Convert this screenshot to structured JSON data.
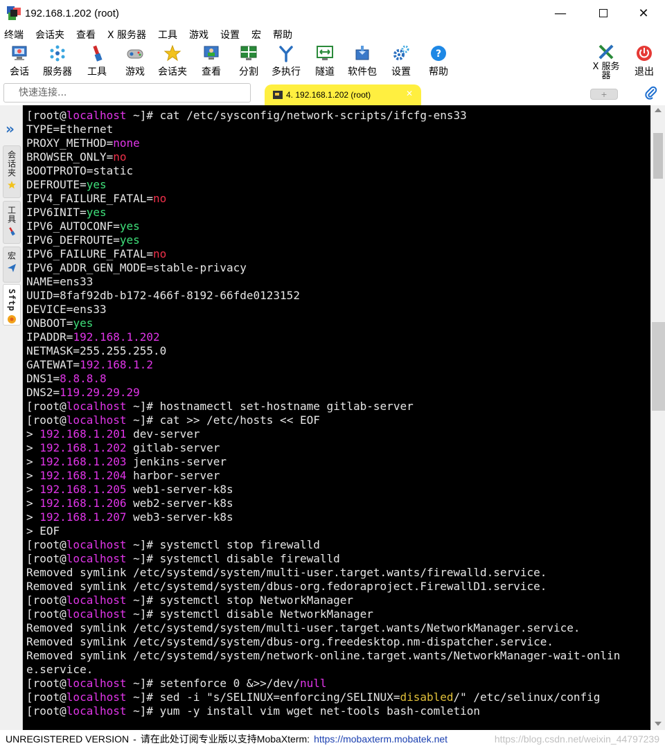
{
  "window": {
    "title": "192.168.1.202 (root)",
    "minimize": "—",
    "close": "✕"
  },
  "menu": [
    "终端",
    "会话夹",
    "查看",
    "X 服务器",
    "工具",
    "游戏",
    "设置",
    "宏",
    "帮助"
  ],
  "toolbar": {
    "session": "会话",
    "servers": "服务器",
    "tools": "工具",
    "games": "游戏",
    "sessions_folder": "会话夹",
    "view": "查看",
    "split": "分割",
    "multiexec": "多执行",
    "tunneling": "隧道",
    "packages": "软件包",
    "settings": "设置",
    "help": "帮助",
    "xserver": "X 服务器",
    "exit": "退出"
  },
  "quick_connect": {
    "placeholder": "快速连接..."
  },
  "tab": {
    "label": "4. 192.168.1.202 (root)",
    "close": "✕",
    "new_tab": "+"
  },
  "sidebar": {
    "sessions": "会话夹",
    "tools": "工具",
    "macros": "宏",
    "sftp": "Sftp"
  },
  "terminal_lines": [
    [
      [
        "w",
        "[root@"
      ],
      [
        "p",
        "localhost"
      ],
      [
        "w",
        " ~]# cat /etc/sysconfig/network-scripts/ifcfg-ens33"
      ]
    ],
    [
      [
        "w",
        "TYPE=Ethernet"
      ]
    ],
    [
      [
        "w",
        "PROXY_METHOD="
      ],
      [
        "p",
        "none"
      ]
    ],
    [
      [
        "w",
        "BROWSER_ONLY="
      ],
      [
        "r",
        "no"
      ]
    ],
    [
      [
        "w",
        "BOOTPROTO=static"
      ]
    ],
    [
      [
        "w",
        "DEFROUTE="
      ],
      [
        "g",
        "yes"
      ]
    ],
    [
      [
        "w",
        "IPV4_FAILURE_FATAL="
      ],
      [
        "r",
        "no"
      ]
    ],
    [
      [
        "w",
        "IPV6INIT="
      ],
      [
        "g",
        "yes"
      ]
    ],
    [
      [
        "w",
        "IPV6_AUTOCONF="
      ],
      [
        "g",
        "yes"
      ]
    ],
    [
      [
        "w",
        "IPV6_DEFROUTE="
      ],
      [
        "g",
        "yes"
      ]
    ],
    [
      [
        "w",
        "IPV6_FAILURE_FATAL="
      ],
      [
        "r",
        "no"
      ]
    ],
    [
      [
        "w",
        "IPV6_ADDR_GEN_MODE=stable-privacy"
      ]
    ],
    [
      [
        "w",
        "NAME=ens33"
      ]
    ],
    [
      [
        "w",
        "UUID=8faf92db-b172-466f-8192-66fde0123152"
      ]
    ],
    [
      [
        "w",
        "DEVICE=ens33"
      ]
    ],
    [
      [
        "w",
        "ONBOOT="
      ],
      [
        "g",
        "yes"
      ]
    ],
    [
      [
        "w",
        "IPADDR="
      ],
      [
        "p",
        "192.168.1.202"
      ]
    ],
    [
      [
        "w",
        "NETMASK=255.255.255.0"
      ]
    ],
    [
      [
        "w",
        "GATEWAT="
      ],
      [
        "p",
        "192.168.1.2"
      ]
    ],
    [
      [
        "w",
        "DNS1="
      ],
      [
        "p",
        "8.8.8.8"
      ]
    ],
    [
      [
        "w",
        "DNS2="
      ],
      [
        "p",
        "119.29.29.29"
      ]
    ],
    [
      [
        "w",
        "[root@"
      ],
      [
        "p",
        "localhost"
      ],
      [
        "w",
        " ~]# hostnamectl set-hostname gitlab-server"
      ]
    ],
    [
      [
        "w",
        "[root@"
      ],
      [
        "p",
        "localhost"
      ],
      [
        "w",
        " ~]# cat >> /etc/hosts << EOF"
      ]
    ],
    [
      [
        "w",
        "> "
      ],
      [
        "p",
        "192.168.1.201"
      ],
      [
        "w",
        " dev-server"
      ]
    ],
    [
      [
        "w",
        "> "
      ],
      [
        "p",
        "192.168.1.202"
      ],
      [
        "w",
        " gitlab-server"
      ]
    ],
    [
      [
        "w",
        "> "
      ],
      [
        "p",
        "192.168.1.203"
      ],
      [
        "w",
        " jenkins-server"
      ]
    ],
    [
      [
        "w",
        "> "
      ],
      [
        "p",
        "192.168.1.204"
      ],
      [
        "w",
        " harbor-server"
      ]
    ],
    [
      [
        "w",
        "> "
      ],
      [
        "p",
        "192.168.1.205"
      ],
      [
        "w",
        " web1-server-k8s"
      ]
    ],
    [
      [
        "w",
        "> "
      ],
      [
        "p",
        "192.168.1.206"
      ],
      [
        "w",
        " web2-server-k8s"
      ]
    ],
    [
      [
        "w",
        "> "
      ],
      [
        "p",
        "192.168.1.207"
      ],
      [
        "w",
        " web3-server-k8s"
      ]
    ],
    [
      [
        "w",
        "> EOF"
      ]
    ],
    [
      [
        "w",
        "[root@"
      ],
      [
        "p",
        "localhost"
      ],
      [
        "w",
        " ~]# systemctl stop firewalld"
      ]
    ],
    [
      [
        "w",
        "[root@"
      ],
      [
        "p",
        "localhost"
      ],
      [
        "w",
        " ~]# systemctl disable firewalld"
      ]
    ],
    [
      [
        "w",
        "Removed symlink /etc/systemd/system/multi-user.target.wants/firewalld.service."
      ]
    ],
    [
      [
        "w",
        "Removed symlink /etc/systemd/system/dbus-org.fedoraproject.FirewallD1.service."
      ]
    ],
    [
      [
        "w",
        "[root@"
      ],
      [
        "p",
        "localhost"
      ],
      [
        "w",
        " ~]# systemctl stop NetworkManager"
      ]
    ],
    [
      [
        "w",
        "[root@"
      ],
      [
        "p",
        "localhost"
      ],
      [
        "w",
        " ~]# systemctl disable NetworkManager"
      ]
    ],
    [
      [
        "w",
        "Removed symlink /etc/systemd/system/multi-user.target.wants/NetworkManager.service."
      ]
    ],
    [
      [
        "w",
        "Removed symlink /etc/systemd/system/dbus-org.freedesktop.nm-dispatcher.service."
      ]
    ],
    [
      [
        "w",
        "Removed symlink /etc/systemd/system/network-online.target.wants/NetworkManager-wait-onlin"
      ]
    ],
    [
      [
        "w",
        "e.service."
      ]
    ],
    [
      [
        "w",
        "[root@"
      ],
      [
        "p",
        "localhost"
      ],
      [
        "w",
        " ~]# setenforce 0 &>>/dev/"
      ],
      [
        "p",
        "null"
      ]
    ],
    [
      [
        "w",
        "[root@"
      ],
      [
        "p",
        "localhost"
      ],
      [
        "w",
        " ~]# sed -i \"s/SELINUX=enforcing/SELINUX="
      ],
      [
        "y",
        "disabled"
      ],
      [
        "w",
        "/\" /etc/selinux/config"
      ]
    ],
    [
      [
        "w",
        "[root@"
      ],
      [
        "p",
        "localhost"
      ],
      [
        "w",
        " ~]# yum -y install vim wget net-tools bash-comletion"
      ]
    ]
  ],
  "status": {
    "unregistered": "UNREGISTERED VERSION",
    "separator": "-",
    "message": "请在此处订阅专业版以支持MobaXterm:",
    "link": "https://mobaxterm.mobatek.net",
    "watermark": "https://blog.csdn.net/weixin_44797239"
  },
  "colors": {
    "terminal_bg": "#000000",
    "terminal_text": "#e6e6e6",
    "hostname": "#e035e8",
    "yes_value": "#3fe07a",
    "no_value": "#f0304a",
    "disabled_value": "#e0c03a",
    "active_tab": "#ffef40"
  },
  "icons": [
    "app-icon",
    "session-icon",
    "servers-icon",
    "tools-icon",
    "games-icon",
    "star-icon",
    "view-icon",
    "split-icon",
    "multiexec-icon",
    "tunnel-icon",
    "packages-icon",
    "settings-icon",
    "help-icon",
    "xserver-icon",
    "exit-icon",
    "paperclip-icon"
  ]
}
